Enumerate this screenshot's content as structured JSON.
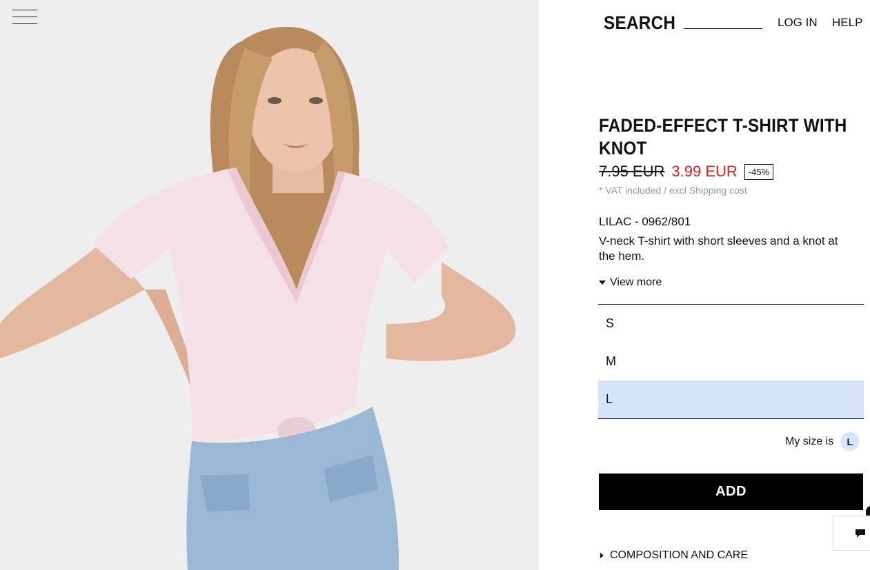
{
  "header": {
    "search_label": "SEARCH",
    "login_label": "LOG IN",
    "help_label": "HELP"
  },
  "product": {
    "title_line1": "FADED-EFFECT T-SHIRT WITH",
    "title_line2": "KNOT",
    "old_price": "7.95 EUR",
    "new_price": "3.99 EUR",
    "discount": "-45%",
    "vat_note": "* VAT included / excl Shipping cost",
    "color_ref": "LILAC - 0962/801",
    "description": "V-neck T-shirt with short sleeves and a knot at the hem.",
    "view_more": "View more"
  },
  "sizes": [
    "S",
    "M",
    "L"
  ],
  "selected_size": "L",
  "my_size": {
    "label": "My size is",
    "value": "L"
  },
  "add_label": "ADD",
  "composition_label": "COMPOSITION AND CARE",
  "colors": {
    "sale_red": "#e02020",
    "selected_size_bg": "#d5e5f7",
    "button_bg": "#000000"
  },
  "icons": {
    "menu": "hamburger-icon",
    "chat": "chat-bubble-icon",
    "expand": "triangle-down-icon",
    "collapse": "triangle-right-icon"
  }
}
